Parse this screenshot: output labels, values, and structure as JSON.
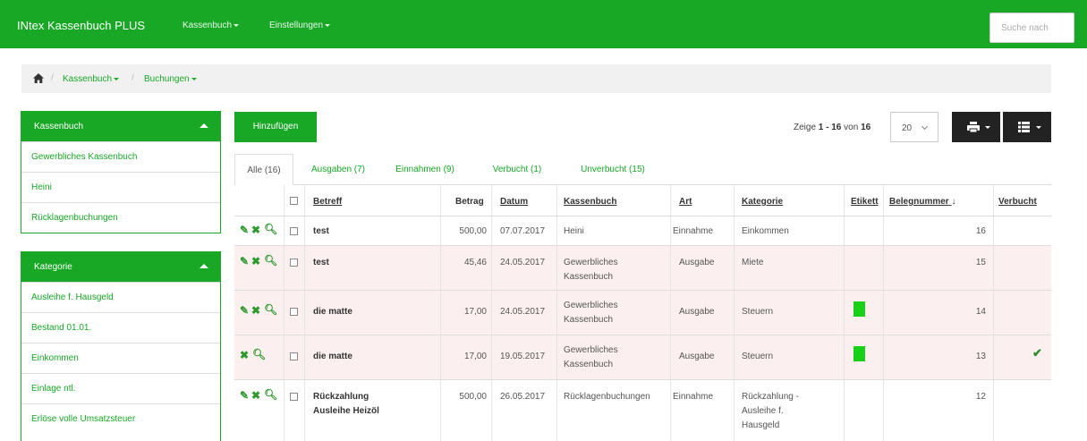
{
  "navbar": {
    "brand": "INtex Kassenbuch PLUS",
    "menu1": "Kassenbuch",
    "menu2": "Einstellungen",
    "search_placeholder": "Suche nach",
    "bg_color": "#18a826"
  },
  "breadcrumb": {
    "home_icon": "home-icon",
    "item1": "Kassenbuch",
    "item2": "Buchungen"
  },
  "sidebar": {
    "kassenbuch": {
      "title": "Kassenbuch",
      "items": [
        "Gewerbliches Kassenbuch",
        "Heini",
        "Rücklagenbuchungen"
      ]
    },
    "kategorie": {
      "title": "Kategorie",
      "items": [
        "Ausleihe f. Hausgeld",
        "Bestand 01.01.",
        "Einkommen",
        "Einlage ntl.",
        "Erlöse volle Umsatzsteuer"
      ]
    }
  },
  "toolbar": {
    "add_label": "Hinzufügen",
    "page_info_prefix": "Zeige",
    "page_info_range": "1 - 16",
    "page_info_mid": "von",
    "page_info_total": "16",
    "page_size": "20",
    "print_icon": "printer-icon",
    "columns_icon": "list-icon"
  },
  "tabs": [
    {
      "label": "Alle (16)",
      "active": true
    },
    {
      "label": "Ausgaben (7)",
      "active": false
    },
    {
      "label": "Einnahmen (9)",
      "active": false
    },
    {
      "label": "Verbucht (1)",
      "active": false
    },
    {
      "label": "Unverbucht (15)",
      "active": false
    }
  ],
  "table": {
    "headers": {
      "betreff": "Betreff",
      "betrag": "Betrag",
      "datum": "Datum",
      "kassenbuch": "Kassenbuch",
      "art": "Art",
      "kategorie": "Kategorie",
      "etikett": "Etikett",
      "belegnummer": "Belegnummer",
      "verbucht": "Verbucht"
    },
    "rows": [
      {
        "betreff": "test",
        "betrag": "500,00",
        "datum": "07.07.2017",
        "kassenbuch": "Heini",
        "art": "Einnahme",
        "kategorie": "Einkommen",
        "etikett": false,
        "belegnummer": "16",
        "verbucht": false,
        "editable": true
      },
      {
        "betreff": "test",
        "betrag": "45,46",
        "datum": "24.05.2017",
        "kassenbuch": "Gewerbliches Kassenbuch",
        "art": "Ausgabe",
        "kategorie": "Miete",
        "etikett": false,
        "belegnummer": "15",
        "verbucht": false,
        "editable": true
      },
      {
        "betreff": "die matte",
        "betrag": "17,00",
        "datum": "24.05.2017",
        "kassenbuch": "Gewerbliches Kassenbuch",
        "art": "Ausgabe",
        "kategorie": "Steuern",
        "etikett": true,
        "belegnummer": "14",
        "verbucht": false,
        "editable": true
      },
      {
        "betreff": "die matte",
        "betrag": "17,00",
        "datum": "19.05.2017",
        "kassenbuch": "Gewerbliches Kassenbuch",
        "art": "Ausgabe",
        "kategorie": "Steuern",
        "etikett": true,
        "belegnummer": "13",
        "verbucht": true,
        "editable": false
      },
      {
        "betreff": "Rückzahlung Ausleihe Heizöl",
        "betrag": "500,00",
        "datum": "26.05.2017",
        "kassenbuch": "Rücklagenbuchungen",
        "art": "Einnahme",
        "kategorie": "Rückzahlung - Ausleihe f. Hausgeld",
        "etikett": false,
        "belegnummer": "12",
        "verbucht": false,
        "editable": true
      }
    ]
  },
  "colors": {
    "accent": "#18a826",
    "label_green": "#18d018",
    "row_alt": "#fbefef"
  }
}
